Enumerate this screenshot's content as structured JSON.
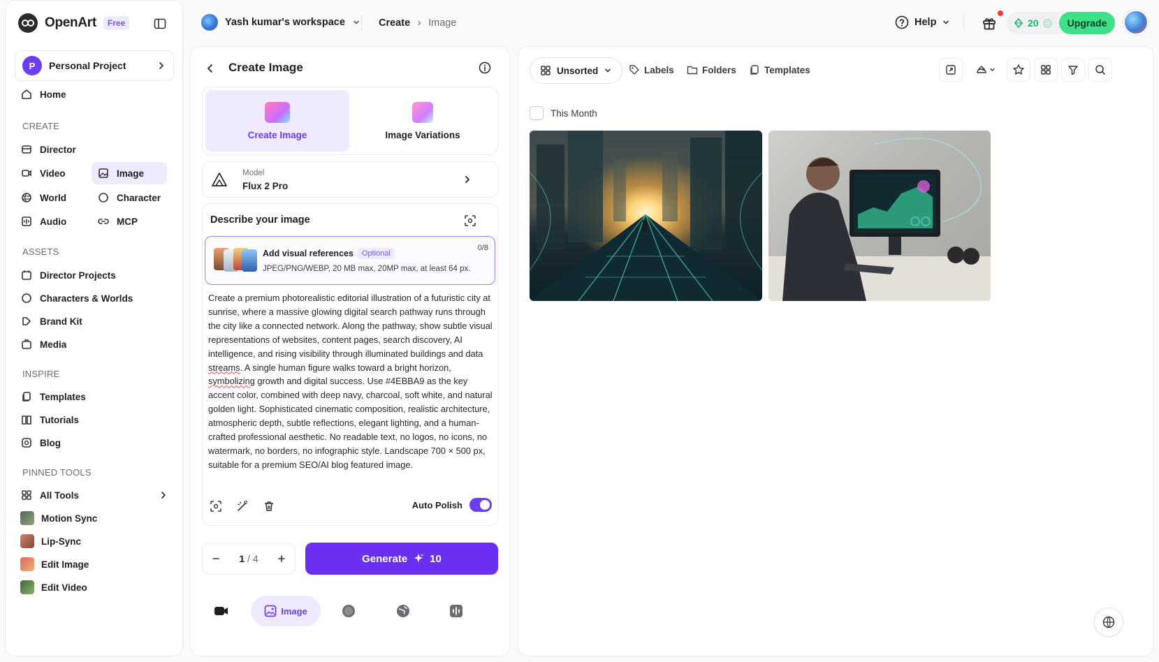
{
  "app": {
    "name": "OpenArt",
    "plan_badge": "Free"
  },
  "sidebar": {
    "project": {
      "initial": "P",
      "name": "Personal Project"
    },
    "home": "Home",
    "create_label": "CREATE",
    "create_items": [
      "Director",
      "Video",
      "Image",
      "World",
      "Character",
      "Audio",
      "MCP"
    ],
    "assets_label": "ASSETS",
    "assets_items": [
      "Director Projects",
      "Characters & Worlds",
      "Brand Kit",
      "Media"
    ],
    "inspire_label": "INSPIRE",
    "inspire_items": [
      "Templates",
      "Tutorials",
      "Blog"
    ],
    "pinned_label": "PINNED TOOLS",
    "pinned_items": [
      "All Tools",
      "Motion Sync",
      "Lip-Sync",
      "Edit Image",
      "Edit Video"
    ]
  },
  "topbar": {
    "workspace": "Yash kumar's workspace",
    "breadcrumb": [
      "Create",
      "Image"
    ],
    "help": "Help",
    "credits": "20",
    "upgrade": "Upgrade"
  },
  "panel": {
    "title": "Create Image",
    "modes": [
      "Create Image",
      "Image Variations"
    ],
    "model_label": "Model",
    "model_value": "Flux 2 Pro",
    "describe_title": "Describe your image",
    "ref_title": "Add visual references",
    "ref_optional": "Optional",
    "ref_sub": "JPEG/PNG/WEBP, 20 MB max, 20MP max, at least 64 px.",
    "ref_count": "0/8",
    "prompt_before": "Create a premium photorealistic editorial illustration of a futuristic city at sunrise, where a massive glowing digital search pathway runs through the city like a connected network. Along the pathway, show subtle visual representations of websites, content pages, search discovery, AI intelligence, and rising visibility through illuminated buildings and data ",
    "prompt_word1": "streams",
    "prompt_mid": ". A single human figure walks toward a bright horizon, ",
    "prompt_word2": "symbolizing",
    "prompt_after": " growth and digital success. Use #4EBBA9 as the key accent color, combined with deep navy, charcoal, soft white, and natural golden light. Sophisticated cinematic composition, realistic architecture, atmospheric depth, subtle reflections, elegant lighting, and a human-crafted professional aesthetic. No readable text, no logos, no icons, no watermark, no borders, no infographic style. Landscape 700 × 500 px, suitable for a premium SEO/AI blog featured image.",
    "auto_polish": "Auto Polish",
    "count_current": "1",
    "count_total": "/ 4",
    "generate": "Generate",
    "generate_cost": "10",
    "bottom_active": "Image"
  },
  "gallery": {
    "sort": "Unsorted",
    "links": [
      "Labels",
      "Folders",
      "Templates"
    ],
    "group_label": "This Month"
  },
  "colors": {
    "accent": "#6b2ff2",
    "accent_soft": "#efeaff",
    "upgrade": "#3ee089",
    "credits": "#18b66b"
  }
}
